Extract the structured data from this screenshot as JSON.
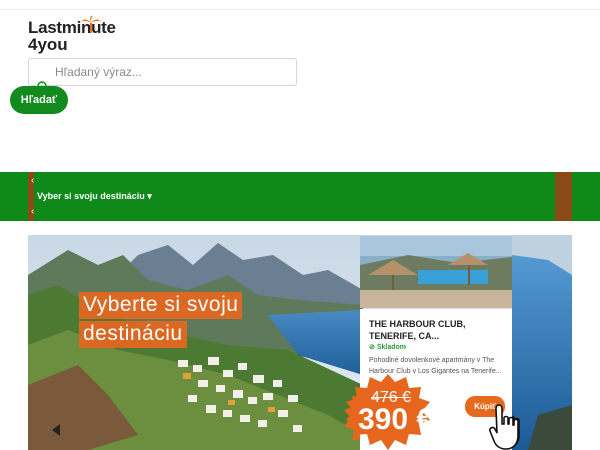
{
  "logo": {
    "line1": "Lastminute",
    "line2": "4you",
    "icon": "palm-tree-icon",
    "accent_color": "#e8731f"
  },
  "search": {
    "placeholder": "Hľadaný výraz...",
    "button_label": "Hľadať",
    "icon": "search-icon"
  },
  "nav": {
    "dropdown_label": "Vyber si svoju destináciu",
    "caret": "▾",
    "chevron_up": "‹",
    "chevron_down": "‹",
    "bg_color": "#0f8a1a",
    "accent_color": "#8a4a16"
  },
  "banner": {
    "headline_line1": "Vyberte si svoju",
    "headline_line2": "destináciu",
    "offer": {
      "title": "THE HARBOUR CLUB, TENERIFE, CA...",
      "stock_label": "Skladom",
      "description": "Pohodlné dovolenkové apartmány v The Harbour Club v Los Gigantes na Tenerife...",
      "old_price": "476 €",
      "new_price": "390 €",
      "buy_label": "Kúpiť"
    }
  },
  "colors": {
    "primary_green": "#128a1e",
    "orange": "#e66a1e"
  }
}
